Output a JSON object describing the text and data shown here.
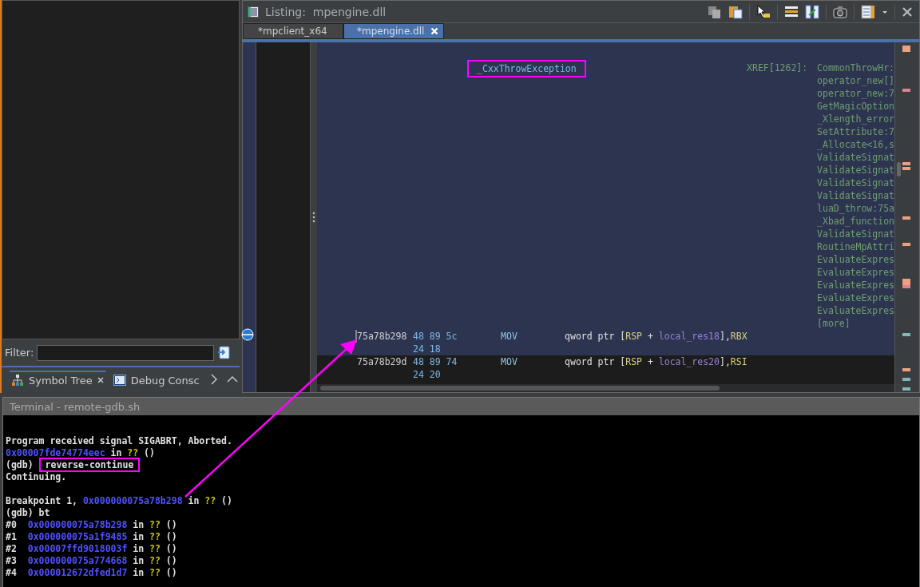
{
  "left_panel": {
    "filter": {
      "label": "Filter:"
    },
    "tabs": [
      {
        "label": "Symbol Tree",
        "kind": "tree",
        "selected": true,
        "closable": true
      },
      {
        "label": "Debug Consc",
        "kind": "console",
        "selected": false,
        "closable": false
      }
    ]
  },
  "listing": {
    "title": "Listing:  mpengine.dll",
    "tabs": [
      {
        "label": "*mpclient_x64",
        "selected": false
      },
      {
        "label": "*mpengine.dll",
        "selected": true
      }
    ],
    "label": "_CxxThrowException",
    "xref_label": "XREF[1262]:",
    "xrefs": [
      "CommonThrowHr:",
      "operator_new[]",
      "operator_new:7",
      "GetMagicOption",
      "_Xlength_error",
      "SetAttribute:7",
      "_Allocate<16,s",
      "ValidateSignat",
      "ValidateSignat",
      "ValidateSignat",
      "ValidateSignat",
      "luaD_throw:75a",
      "_Xbad_function",
      "ValidateSignat",
      "RoutineMpAttri",
      "EvaluateExpres",
      "EvaluateExpres",
      "EvaluateExpres",
      "EvaluateExpres",
      "EvaluateExpres",
      "[more]"
    ],
    "instructions": [
      {
        "address": "75a78b298",
        "bytes": [
          "48 89 5c",
          "24 18"
        ],
        "mnemonic": "MOV",
        "highlighted": true,
        "operands": [
          {
            "text": "qword ptr [",
            "kind": "plain"
          },
          {
            "text": "RSP",
            "kind": "register"
          },
          {
            "text": " + ",
            "kind": "plain"
          },
          {
            "text": "local_res18",
            "kind": "variable"
          },
          {
            "text": "],",
            "kind": "plain"
          },
          {
            "text": "RBX",
            "kind": "register"
          }
        ]
      },
      {
        "address": "75a78b29d",
        "bytes": [
          "48 89 74",
          "24 20"
        ],
        "mnemonic": "MOV",
        "highlighted": false,
        "operands": [
          {
            "text": "qword ptr [",
            "kind": "plain"
          },
          {
            "text": "RSP",
            "kind": "register"
          },
          {
            "text": " + ",
            "kind": "plain"
          },
          {
            "text": "local_res20",
            "kind": "variable"
          },
          {
            "text": "],",
            "kind": "plain"
          },
          {
            "text": "RSI",
            "kind": "register"
          }
        ]
      }
    ]
  },
  "terminal": {
    "title": "Terminal - remote-gdb.sh",
    "blocks": [
      {
        "lines": [
          {
            "segments": [
              {
                "text": "Program received signal SIGABRT, Aborted.",
                "kind": "plain"
              }
            ]
          },
          {
            "segments": [
              {
                "text": "0x00007fde74774eec",
                "kind": "address"
              },
              {
                "text": " in ",
                "kind": "plain"
              },
              {
                "text": "??",
                "kind": "unknown"
              },
              {
                "text": " ()",
                "kind": "plain"
              }
            ]
          },
          {
            "segments": [
              {
                "text": "(gdb) ",
                "kind": "plain"
              },
              {
                "text": "reverse-continue",
                "kind": "command"
              }
            ]
          },
          {
            "segments": [
              {
                "text": "Continuing.",
                "kind": "plain"
              }
            ]
          }
        ]
      },
      {
        "lines": [
          {
            "segments": [
              {
                "text": "Breakpoint 1, ",
                "kind": "plain"
              },
              {
                "text": "0x000000075a78b298",
                "kind": "address"
              },
              {
                "text": " in ",
                "kind": "plain"
              },
              {
                "text": "??",
                "kind": "unknown"
              },
              {
                "text": " ()",
                "kind": "plain"
              }
            ]
          },
          {
            "segments": [
              {
                "text": "(gdb) bt",
                "kind": "plain"
              }
            ]
          },
          {
            "segments": [
              {
                "text": "#0  ",
                "kind": "plain"
              },
              {
                "text": "0x000000075a78b298",
                "kind": "address"
              },
              {
                "text": " in ",
                "kind": "plain"
              },
              {
                "text": "??",
                "kind": "unknown"
              },
              {
                "text": " ()",
                "kind": "plain"
              }
            ]
          },
          {
            "segments": [
              {
                "text": "#1  ",
                "kind": "plain"
              },
              {
                "text": "0x000000075a1f9485",
                "kind": "address"
              },
              {
                "text": " in ",
                "kind": "plain"
              },
              {
                "text": "??",
                "kind": "unknown"
              },
              {
                "text": " ()",
                "kind": "plain"
              }
            ]
          },
          {
            "segments": [
              {
                "text": "#2  ",
                "kind": "plain"
              },
              {
                "text": "0x00007ffd9018003f",
                "kind": "address"
              },
              {
                "text": " in ",
                "kind": "plain"
              },
              {
                "text": "??",
                "kind": "unknown"
              },
              {
                "text": " ()",
                "kind": "plain"
              }
            ]
          },
          {
            "segments": [
              {
                "text": "#3  ",
                "kind": "plain"
              },
              {
                "text": "0x000000075a774668",
                "kind": "address"
              },
              {
                "text": " in ",
                "kind": "plain"
              },
              {
                "text": "??",
                "kind": "unknown"
              },
              {
                "text": " ()",
                "kind": "plain"
              }
            ]
          },
          {
            "segments": [
              {
                "text": "#4  ",
                "kind": "plain"
              },
              {
                "text": "0x000012672dfed1d7",
                "kind": "address"
              },
              {
                "text": " in ",
                "kind": "plain"
              },
              {
                "text": "??",
                "kind": "unknown"
              },
              {
                "text": " ()",
                "kind": "plain"
              }
            ]
          }
        ]
      }
    ]
  }
}
